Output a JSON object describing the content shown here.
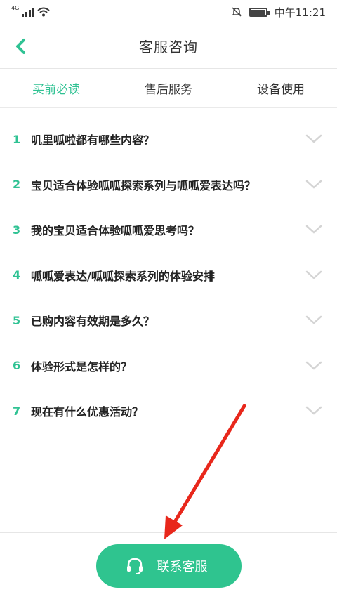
{
  "status_bar": {
    "network": "4G",
    "time": "中午11:21"
  },
  "header": {
    "title": "客服咨询"
  },
  "tabs": [
    {
      "label": "买前必读",
      "active": true
    },
    {
      "label": "售后服务",
      "active": false
    },
    {
      "label": "设备使用",
      "active": false
    }
  ],
  "faq": [
    {
      "num": "1",
      "text": "叽里呱啦都有哪些内容？"
    },
    {
      "num": "2",
      "text": "宝贝适合体验呱呱探索系列与呱呱爱表达吗？"
    },
    {
      "num": "3",
      "text": "我的宝贝适合体验呱呱爱思考吗？"
    },
    {
      "num": "4",
      "text": "呱呱爱表达/呱呱探索系列的体验安排"
    },
    {
      "num": "5",
      "text": "已购内容有效期是多久？"
    },
    {
      "num": "6",
      "text": "体验形式是怎样的？"
    },
    {
      "num": "7",
      "text": "现在有什么优惠活动？"
    }
  ],
  "footer": {
    "contact_label": "联系客服"
  },
  "colors": {
    "accent": "#2fc293",
    "button": "#2fc48f",
    "annotation_arrow": "#e8271b"
  }
}
